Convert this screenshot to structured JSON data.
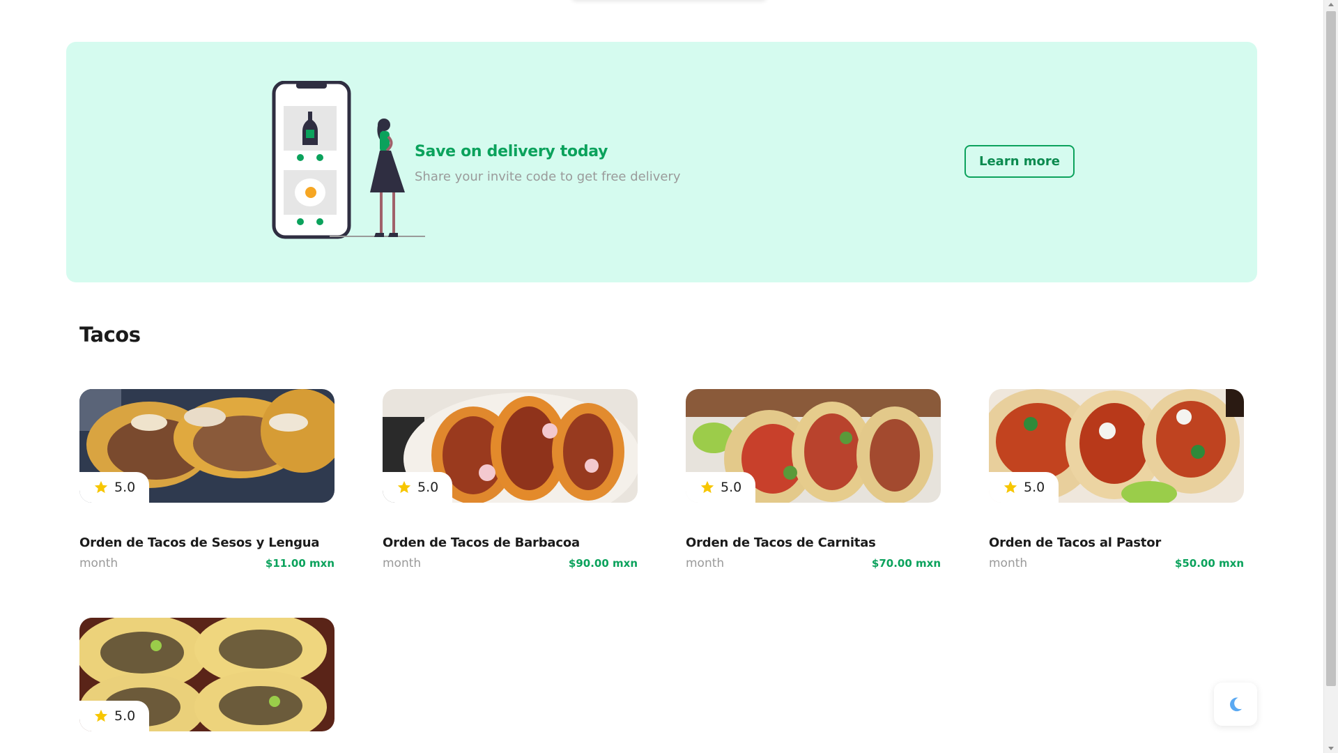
{
  "banner": {
    "title": "Save on delivery today",
    "subtitle": "Share your invite code to get free delivery",
    "button_label": "Learn more",
    "background_color": "#d5fbef",
    "accent_color": "#0ba25c",
    "illustration_icon": "phone-order-illustration"
  },
  "section": {
    "title": "Tacos"
  },
  "products": [
    {
      "name": "Orden de Tacos de Sesos y Lengua",
      "unit": "month",
      "price": "$11.00 mxn",
      "rating": "5.0"
    },
    {
      "name": "Orden de Tacos de Barbacoa",
      "unit": "month",
      "price": "$90.00 mxn",
      "rating": "5.0"
    },
    {
      "name": "Orden de Tacos de Carnitas",
      "unit": "month",
      "price": "$70.00 mxn",
      "rating": "5.0"
    },
    {
      "name": "Orden de Tacos al Pastor",
      "unit": "month",
      "price": "$50.00 mxn",
      "rating": "5.0"
    },
    {
      "name": "",
      "unit": "",
      "price": "",
      "rating": "5.0"
    }
  ],
  "icons": {
    "rating": "star-icon",
    "theme_toggle": "moon-icon"
  },
  "colors": {
    "price": "#0ba25c",
    "star": "#f7c600",
    "moon": "#5aa9f2"
  }
}
